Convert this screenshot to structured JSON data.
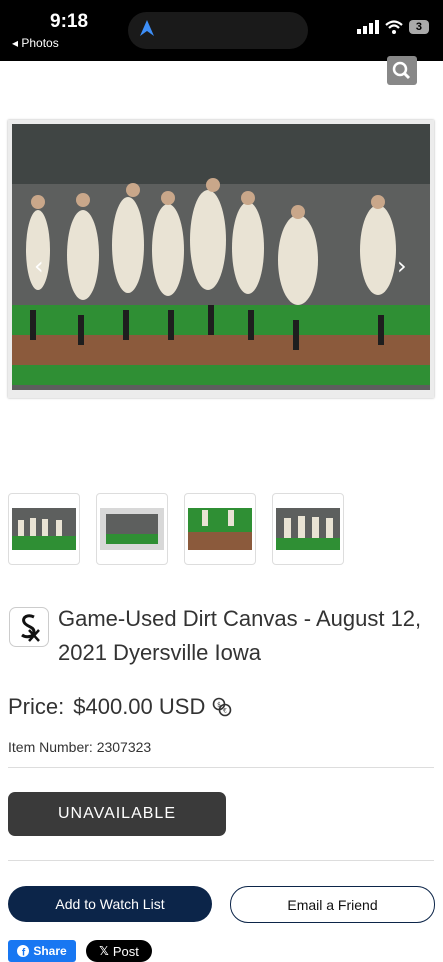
{
  "status": {
    "time": "9:18",
    "back_label": "◂ Photos",
    "battery": "3"
  },
  "product": {
    "title": "Game-Used Dirt Canvas - August 12, 2021 Dyersville Iowa",
    "price_label": "Price:",
    "price_value": "$400.00 USD",
    "item_number": "Item Number: 2307323"
  },
  "actions": {
    "unavailable": "UNAVAILABLE",
    "watch_list": "Add to Watch List",
    "email_friend": "Email a Friend",
    "share": "Share",
    "post": "Post"
  },
  "icons": {
    "search": "search-icon",
    "currency": "currency-exchange-icon",
    "logo": "white-sox-logo",
    "facebook": "facebook-icon",
    "x": "x-icon"
  },
  "colors": {
    "primary": "#0c2549",
    "unavailable": "#3a3a3a",
    "facebook": "#1877f2"
  }
}
